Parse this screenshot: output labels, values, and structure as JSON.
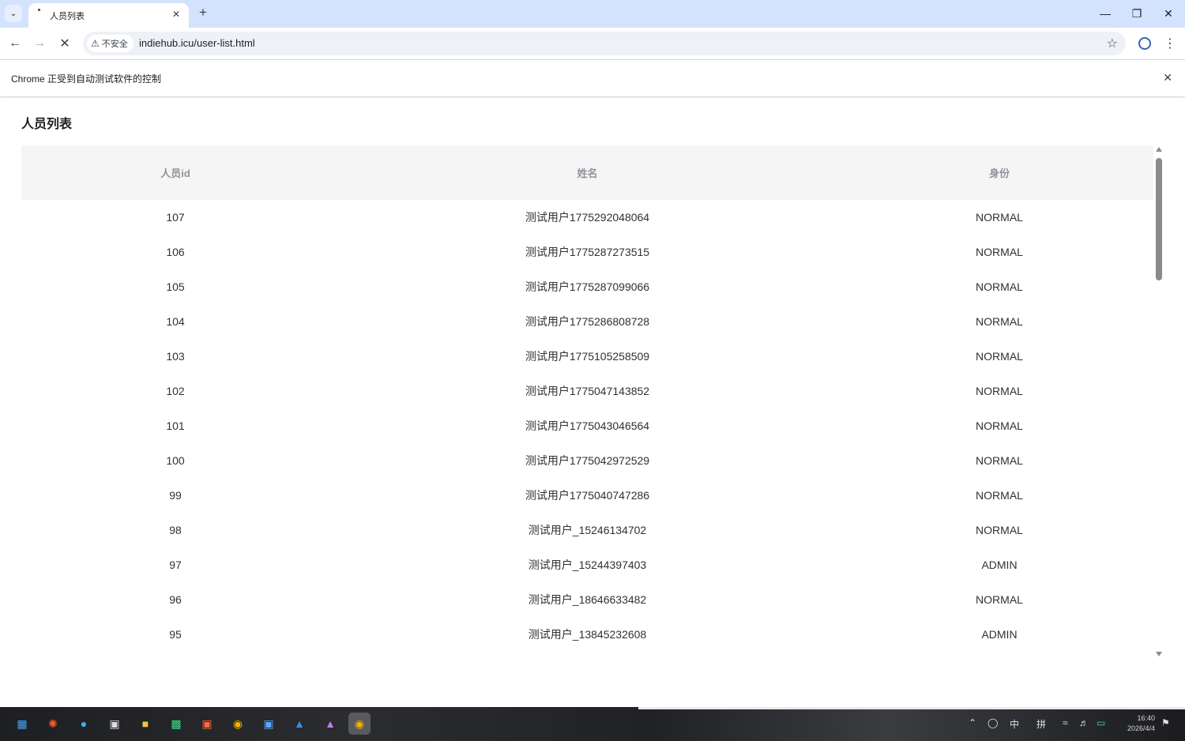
{
  "browser": {
    "tab_title": "人员列表",
    "url": "indiehub.icu/user-list.html",
    "security_label": "不安全",
    "automation_notice": "Chrome 正受到自动测试软件的控制"
  },
  "page": {
    "title": "人员列表",
    "columns": [
      "人员id",
      "姓名",
      "身份"
    ],
    "rows": [
      {
        "id": "107",
        "name": "测试用户1775292048064",
        "role": "NORMAL"
      },
      {
        "id": "106",
        "name": "测试用户1775287273515",
        "role": "NORMAL"
      },
      {
        "id": "105",
        "name": "测试用户1775287099066",
        "role": "NORMAL"
      },
      {
        "id": "104",
        "name": "测试用户1775286808728",
        "role": "NORMAL"
      },
      {
        "id": "103",
        "name": "测试用户1775105258509",
        "role": "NORMAL"
      },
      {
        "id": "102",
        "name": "测试用户1775047143852",
        "role": "NORMAL"
      },
      {
        "id": "101",
        "name": "测试用户1775043046564",
        "role": "NORMAL"
      },
      {
        "id": "100",
        "name": "测试用户1775042972529",
        "role": "NORMAL"
      },
      {
        "id": "99",
        "name": "测试用户1775040747286",
        "role": "NORMAL"
      },
      {
        "id": "98",
        "name": "测试用户_15246134702",
        "role": "NORMAL"
      },
      {
        "id": "97",
        "name": "测试用户_15244397403",
        "role": "ADMIN"
      },
      {
        "id": "96",
        "name": "测试用户_18646633482",
        "role": "NORMAL"
      },
      {
        "id": "95",
        "name": "测试用户_13845232608",
        "role": "ADMIN"
      }
    ]
  },
  "taskbar": {
    "ime_mode": "中",
    "ime_layout": "拼",
    "time": "16:40",
    "date": "2026/4/4"
  },
  "icons": {
    "tab_search": "chevron-down-icon",
    "close": "close-icon",
    "new_tab": "plus-icon",
    "back": "arrow-left-icon",
    "forward": "arrow-right-icon",
    "stop": "close-icon",
    "warning": "warning-triangle-icon",
    "bookmark": "star-icon",
    "profile": "profile-icon",
    "menu": "kebab-menu-icon"
  },
  "colors": {
    "tabstrip": "#d3e3fd",
    "table_header_bg": "#f5f5f6",
    "header_text": "#909399",
    "cell_text": "#303133"
  }
}
